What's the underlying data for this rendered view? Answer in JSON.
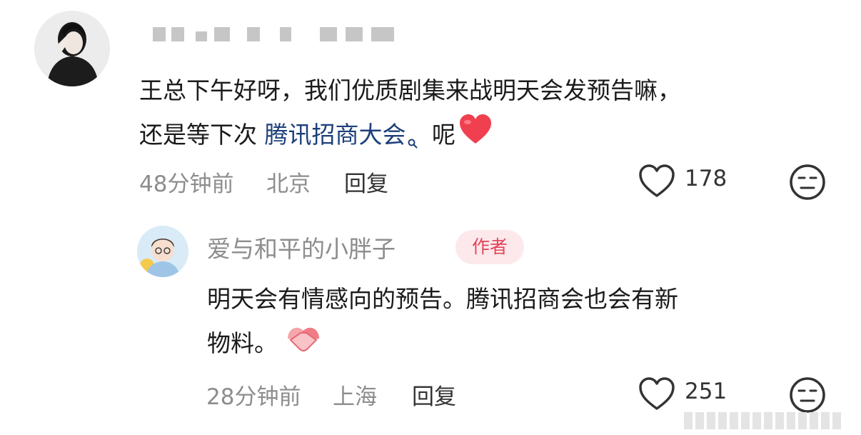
{
  "comment": {
    "text_line1": "王总下午好呀，我们优质剧集来战明天会发预告嘛，",
    "text_line2_before": "还是等下次 ",
    "link_text": "腾讯招商大会",
    "text_line2_after": " 呢",
    "time": "48分钟前",
    "location": "北京",
    "reply_label": "回复",
    "like_count": "178"
  },
  "reply": {
    "username": "爱与和平的小胖子",
    "badge": "作者",
    "text_line1": "明天会有情感向的预告。腾讯招商会也会有新",
    "text_line2": "物料。",
    "time": "28分钟前",
    "location": "上海",
    "reply_label": "回复",
    "like_count": "251"
  },
  "colors": {
    "link": "#1d3f7a",
    "heart_emoji": "#f0404f",
    "author_badge_bg": "#fde9ec",
    "author_badge_text": "#e24558"
  },
  "icons": {
    "like": "heart-outline-icon",
    "dislike": "meh-face-icon",
    "search_hint": "search-icon",
    "emoji_heart": "red-heart-emoji",
    "emoji_handshake": "handshake-emoji"
  }
}
